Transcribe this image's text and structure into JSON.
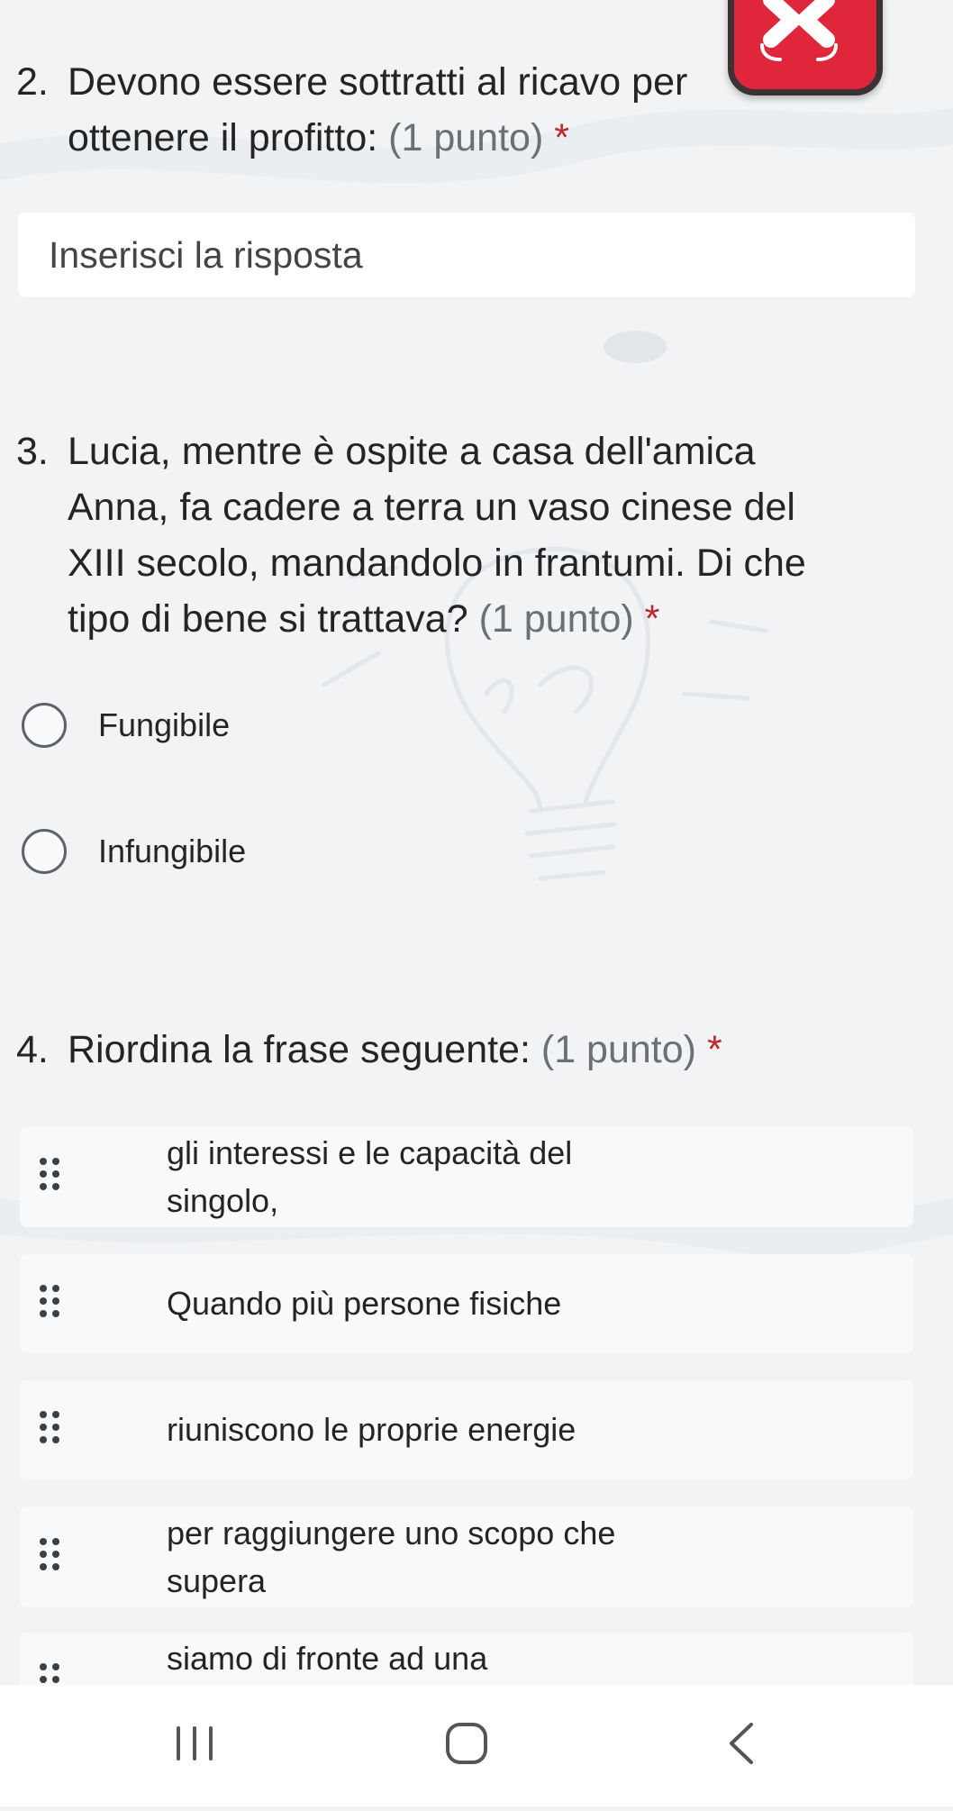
{
  "questions": [
    {
      "number": "2.",
      "text_lines": [
        "Devono essere sottratti al ricavo per",
        "ottenere il profitto:"
      ],
      "points": "(1 punto)",
      "required": "*",
      "answer": {
        "value": "",
        "placeholder": "Inserisci la risposta"
      }
    },
    {
      "number": "3.",
      "text_lines": [
        "Lucia, mentre è ospite a casa dell'amica",
        "Anna, fa cadere a terra un vaso cinese del",
        "XIII secolo, mandandolo in frantumi. Di che",
        "tipo di bene si trattava?"
      ],
      "points": "(1 punto)",
      "required": "*",
      "options": [
        "Fungibile",
        "Infungibile"
      ]
    },
    {
      "number": "4.",
      "text_lines": [
        "Riordina la frase seguente:"
      ],
      "points": "(1 punto)",
      "required": "*",
      "order_items": [
        [
          "gli interessi e le capacità del",
          "singolo,"
        ],
        [
          "Quando più persone fisiche"
        ],
        [
          "riuniscono le proprie energie"
        ],
        [
          "per raggiungere uno scopo che",
          "supera"
        ],
        [
          "siamo di fronte ad una"
        ]
      ]
    }
  ],
  "icons": {
    "badge": "close-x-icon",
    "grip": "drag-handle-icon",
    "nav_recent": "recent-apps-icon",
    "nav_home": "home-icon",
    "nav_back": "back-icon"
  },
  "colors": {
    "badge": "#e0263a",
    "required": "#c0262d",
    "points": "#6b6f76",
    "background": "#f1f3f5"
  }
}
